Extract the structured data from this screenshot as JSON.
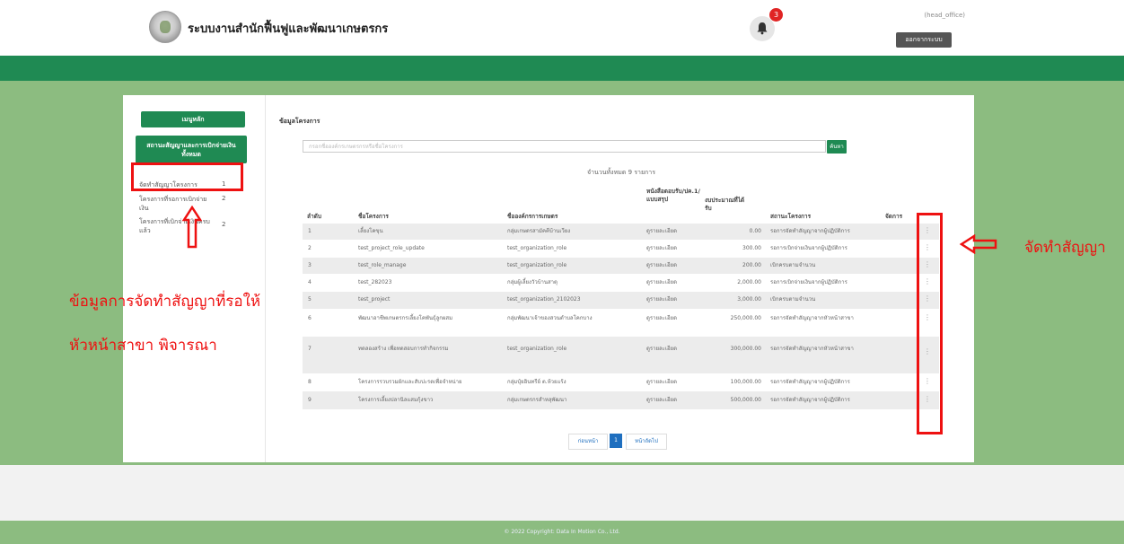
{
  "header": {
    "app_title": "ระบบงานสำนักฟื้นฟูและพัฒนาเกษตรกร",
    "notification_count": "3",
    "user_name": "(head_office)",
    "logout_label": "ออกจากระบบ"
  },
  "sidebar": {
    "menu_button": "เมนูหลัก",
    "status_button": "สถานะสัญญาและการเบิกจ่ายเงินทั้งหมด",
    "items": [
      {
        "label": "จัดทำสัญญาโครงการ",
        "count": "1"
      },
      {
        "label": "โครงการที่รอการเบิกจ่ายเงิน",
        "count": "2"
      },
      {
        "label": "โครงการที่เบิกจ่ายเงินครบแล้ว",
        "count": "2"
      }
    ]
  },
  "main": {
    "section_title": "ข้อมูลโครงการ",
    "search_placeholder": "กรอกชื่อองค์กรเกษตรกรหรือชื่อโครงการ",
    "search_button": "ค้นหา",
    "total_count": "จำนวนทั้งหมด 9 รายการ",
    "columns": [
      "ลำดับ",
      "ชื่อโครงการ",
      "ชื่อองค์กรการเกษตร",
      "หนังสือตอบรับ/ปค.1/แบบสรุป",
      "งบประมาณที่ได้รับ",
      "สถานะโครงการ",
      "จัดการ"
    ],
    "rows": [
      {
        "no": "1",
        "project": "เลี้ยงโคขุน",
        "org": "กลุ่มเกษตรสามัคคีบ้านเวียง",
        "doc": "ดูรายละเอียด",
        "budget": "0.00",
        "status": "รอการจัดทำสัญญาจากผู้ปฏิบัติการ"
      },
      {
        "no": "2",
        "project": "test_project_role_update",
        "org": "test_organization_role",
        "doc": "ดูรายละเอียด",
        "budget": "300.00",
        "status": "รอการเบิกจ่ายเงินจากผู้ปฏิบัติการ"
      },
      {
        "no": "3",
        "project": "test_role_manage",
        "org": "test_organization_role",
        "doc": "ดูรายละเอียด",
        "budget": "200.00",
        "status": "เบิกครบตามจำนวน"
      },
      {
        "no": "4",
        "project": "test_282023",
        "org": "กลุ่มผู้เลี้ยงวัวบ้านสาตุ",
        "doc": "ดูรายละเอียด",
        "budget": "2,000.00",
        "status": "รอการเบิกจ่ายเงินจากผู้ปฏิบัติการ"
      },
      {
        "no": "5",
        "project": "test_project",
        "org": "test_organization_2102023",
        "doc": "ดูรายละเอียด",
        "budget": "3,000.00",
        "status": "เบิกครบตามจำนวน"
      },
      {
        "no": "6",
        "project": "พัฒนาอาชีพเกษตรกรเลี้ยงโคพันธุ์ลูกผสม",
        "org": "กลุ่มพัฒนาเจ้าของสวนตำบลโคกบาง",
        "doc": "ดูรายละเอียด",
        "budget": "250,000.00",
        "status": "รอการจัดทำสัญญาจากหัวหน้าสาขา"
      },
      {
        "no": "7",
        "project": "ทดลองสร้าง เพื่อทดสอบการทำกิจกรรม",
        "org": "test_organization_role",
        "doc": "ดูรายละเอียด",
        "budget": "300,000.00",
        "status": "รอการจัดทำสัญญาจากหัวหน้าสาขา"
      },
      {
        "no": "8",
        "project": "โครงการรวบรวมผักและสับปะรดเพื่อจำหน่าย",
        "org": "กลุ่มปุ๋ยอินทรีย์ ต.ห้วยแร้ง",
        "doc": "ดูรายละเอียด",
        "budget": "100,000.00",
        "status": "รอการจัดทำสัญญาจากผู้ปฏิบัติการ"
      },
      {
        "no": "9",
        "project": "โครงการเลี้ยงปลานิลแสมกุ้งขาว",
        "org": "กลุ่มเกษตรกรสำหลุพัฒนา",
        "doc": "ดูรายละเอียด",
        "budget": "500,000.00",
        "status": "รอการจัดทำสัญญาจากผู้ปฏิบัติการ"
      }
    ],
    "pagination": {
      "prev": "ก่อนหน้า",
      "current": "1",
      "next": "หน้าถัดไป"
    }
  },
  "footer": {
    "copyright": "© 2022 Copyright: Data In Motion Co., Ltd."
  },
  "annotations": {
    "left_note_line1": "ข้อมูลการจัดทำสัญญาที่รอให้",
    "left_note_line2": "หัวหน้าสาขา พิจารณา",
    "right_note": "จัดทำสัญญา"
  },
  "colors": {
    "primary_green": "#1f8a53",
    "page_green": "#8cbc80",
    "annotation_red": "#e11111",
    "badge_red": "#e02424",
    "pager_blue": "#1f6fbf"
  }
}
